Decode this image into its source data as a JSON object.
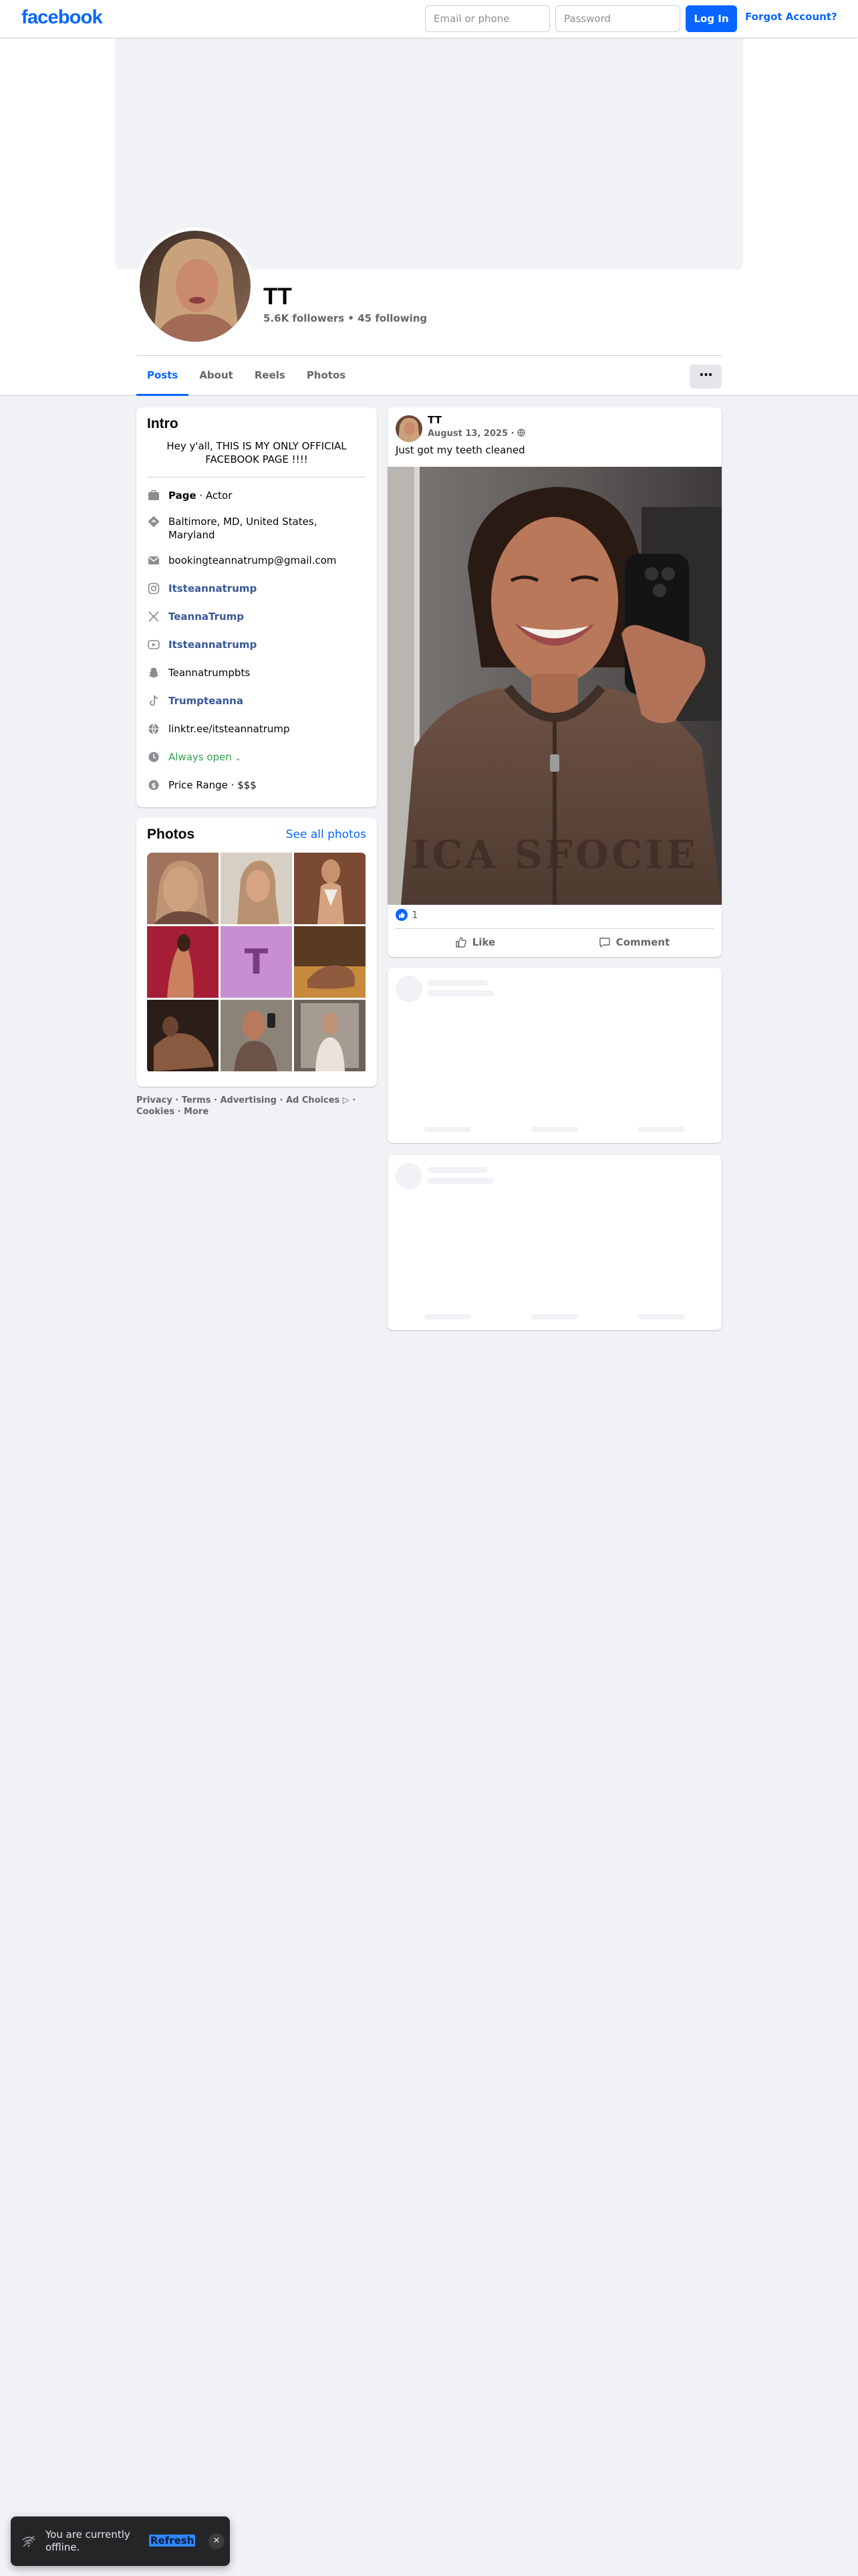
{
  "topbar": {
    "logo": "facebook",
    "email_placeholder": "Email or phone",
    "password_placeholder": "Password",
    "login_label": "Log In",
    "forgot_label": "Forgot Account?"
  },
  "profile": {
    "name": "TT",
    "followers_line": "5.6K followers • 45 following"
  },
  "tabs": [
    {
      "label": "Posts",
      "active": true
    },
    {
      "label": "About"
    },
    {
      "label": "Reels"
    },
    {
      "label": "Photos"
    }
  ],
  "more_label": "···",
  "intro": {
    "title": "Intro",
    "bio": "Hey y'all, THIS IS MY ONLY OFFICIAL FACEBOOK PAGE !!!!",
    "category_prefix": "Page",
    "category": " · Actor",
    "location": "Baltimore, MD, United States, Maryland",
    "email": "bookingteannatrump@gmail.com",
    "instagram": "Itsteannatrump",
    "x": "TeannaTrump",
    "youtube": "Itsteannatrump",
    "snapchat": "Teannatrumpbts",
    "tiktok": "Trumpteanna",
    "website": "linktr.ee/itsteannatrump",
    "hours": "Always open",
    "price": "Price Range · $$$"
  },
  "photos": {
    "title": "Photos",
    "see_all": "See all photos",
    "text_tile": "T"
  },
  "footer": {
    "line1": "Privacy · Terms · Advertising · Ad Choices ▷ ·",
    "line2": "Cookies · More"
  },
  "post": {
    "author": "TT",
    "date": "August 13, 2025 ·",
    "text": "Just got my teeth cleaned",
    "reaction_count": "1",
    "like_label": "Like",
    "comment_label": "Comment"
  },
  "toast": {
    "text": "You are currently offline.",
    "action": "Refresh"
  },
  "colors": {
    "brand": "#0866ff",
    "background": "#f0f2f5",
    "link": "#385898",
    "open": "#31a24c"
  }
}
